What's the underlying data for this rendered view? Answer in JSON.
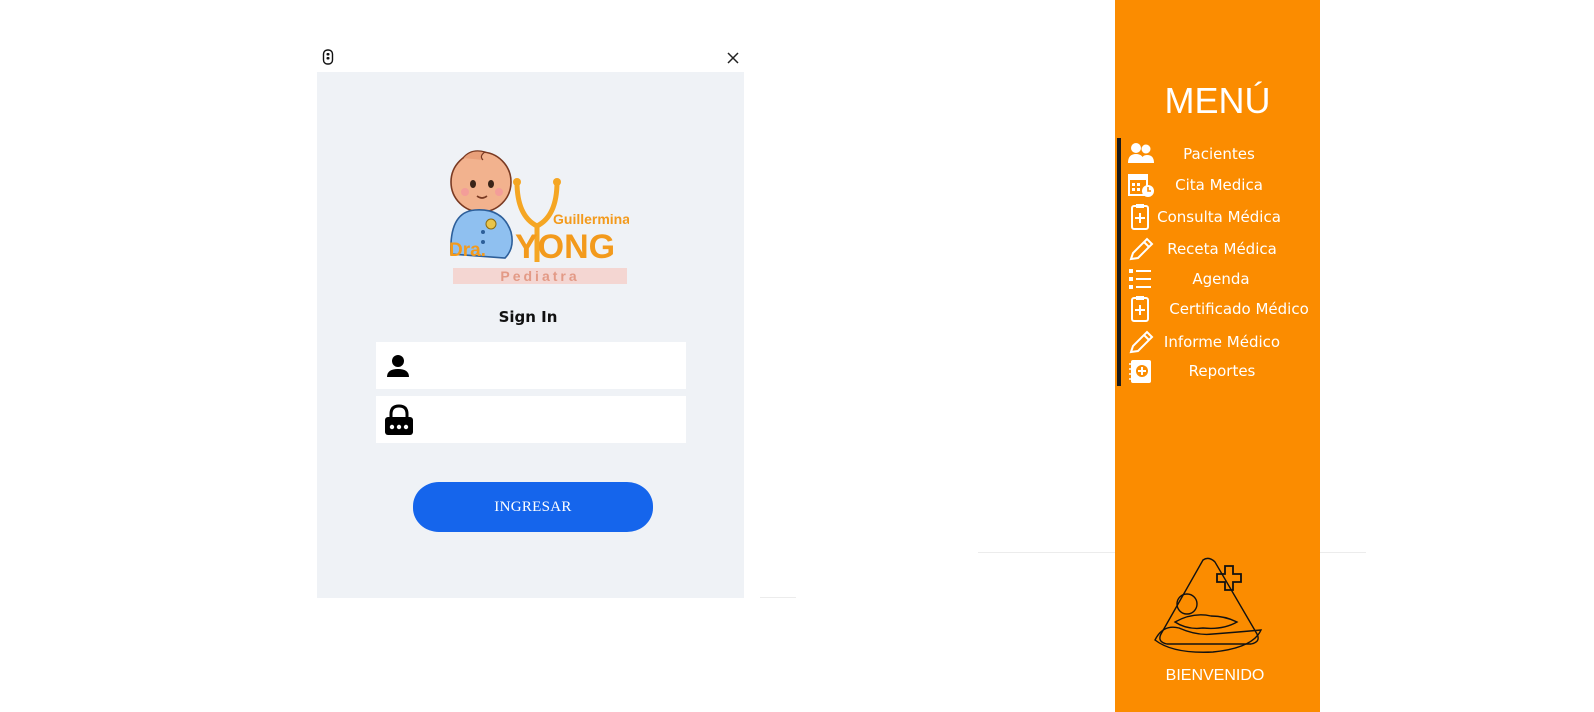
{
  "login": {
    "logo": {
      "name_top": "Guillermina",
      "name_prefix": "Dra.",
      "name_main": "YONG",
      "specialty": "Pediatra"
    },
    "title": "Sign In",
    "username_value": "",
    "password_value": "",
    "submit_label": "INGRESAR"
  },
  "sidebar": {
    "title": "MENÚ",
    "items": [
      {
        "label": "Pacientes",
        "icon": "patients-icon"
      },
      {
        "label": "Cita Medica",
        "icon": "calendar-icon"
      },
      {
        "label": "Consulta Médica",
        "icon": "clipboard-plus-icon"
      },
      {
        "label": "Receta Médica",
        "icon": "pen-icon"
      },
      {
        "label": "Agenda",
        "icon": "list-icon"
      },
      {
        "label": "Certificado Médico",
        "icon": "clipboard-plus-icon"
      },
      {
        "label": "Informe Médico",
        "icon": "pen-icon"
      },
      {
        "label": "Reportes",
        "icon": "report-icon"
      }
    ],
    "welcome": "BIENVENIDO"
  },
  "colors": {
    "sidebar_bg": "#fb8c00",
    "login_bg": "#eff2f6",
    "button": "#1565ec",
    "logo_orange": "#f39a1c"
  }
}
